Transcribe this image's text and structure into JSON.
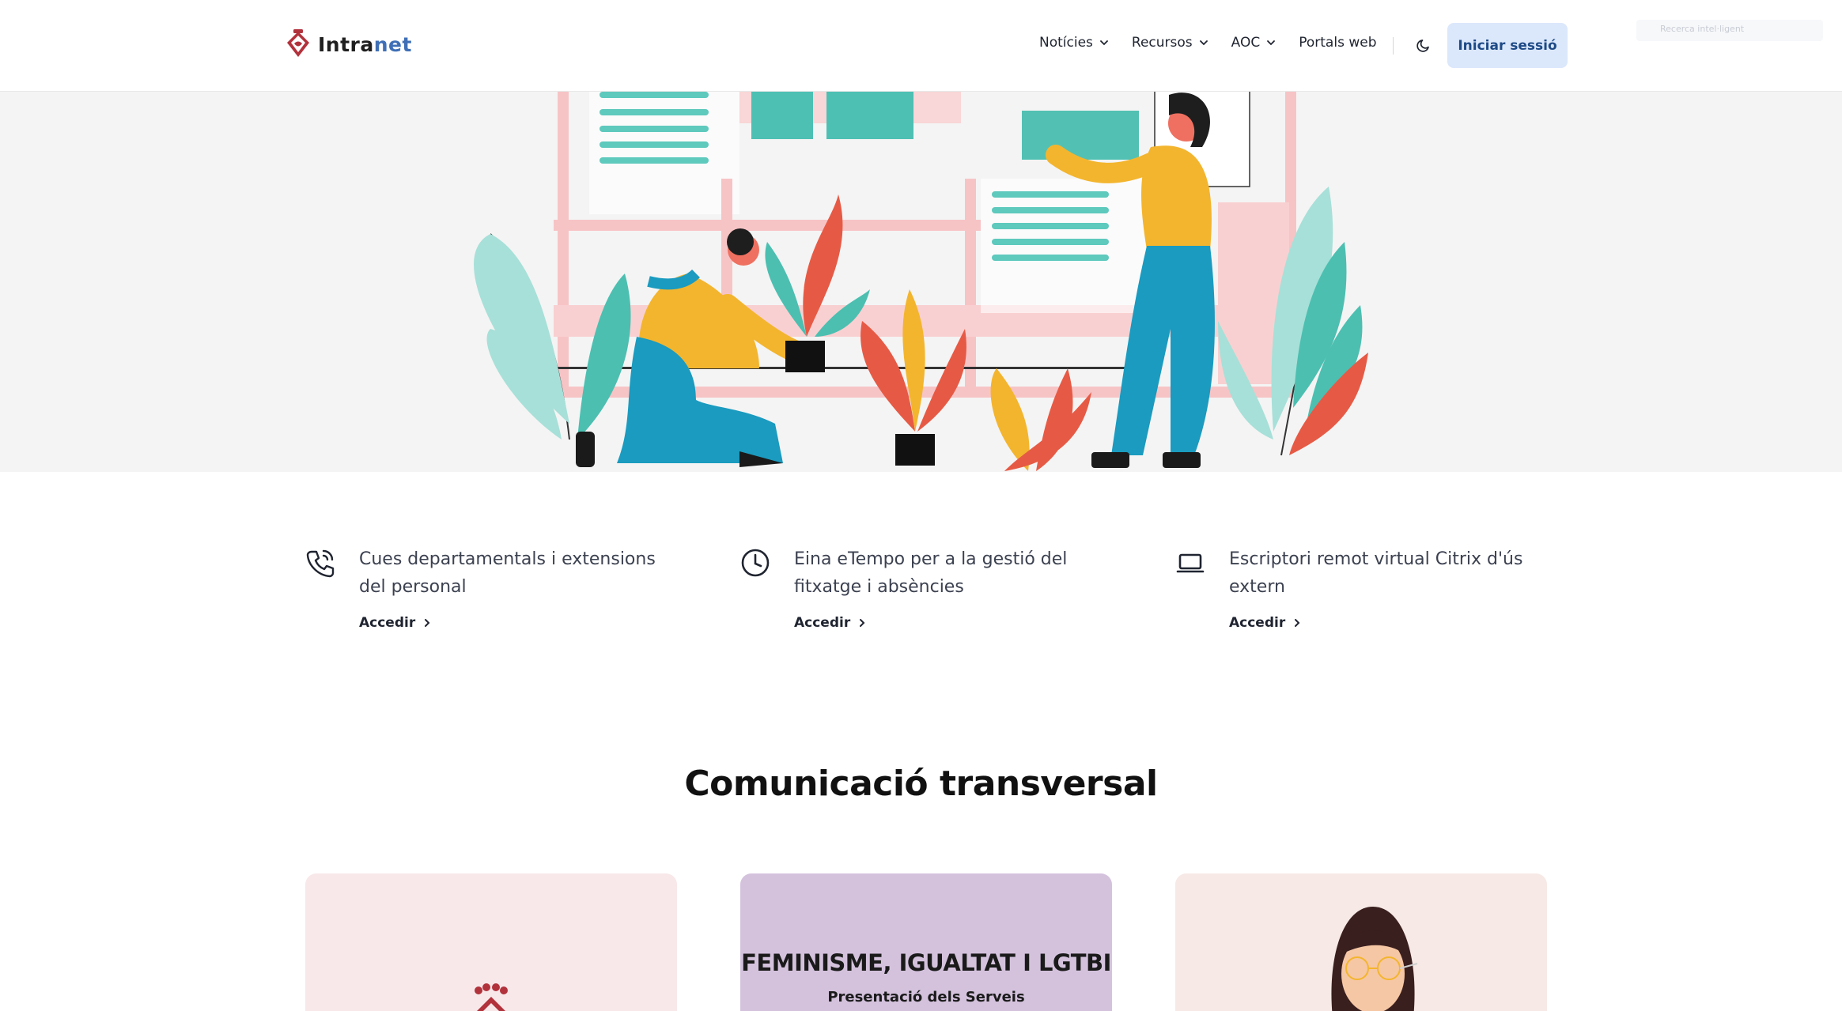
{
  "header": {
    "logo_text_a": "Intra",
    "logo_text_b": "net",
    "nav": [
      {
        "label": "Notícies",
        "has_dropdown": true
      },
      {
        "label": "Recursos",
        "has_dropdown": true
      },
      {
        "label": "AOC",
        "has_dropdown": true
      },
      {
        "label": "Portals web",
        "has_dropdown": false
      }
    ],
    "theme_toggle_icon": "moon-icon",
    "login_label": "Iniciar sessió",
    "mini_search_placeholder": "Recerca intel·ligent"
  },
  "quick_links": [
    {
      "icon": "phone-call-icon",
      "title": "Cues departamentals i extensions del personal",
      "link": "Accedir"
    },
    {
      "icon": "clock-icon",
      "title": "Eina eTempo per a la gestió del fitxatge i absències",
      "link": "Accedir"
    },
    {
      "icon": "laptop-icon",
      "title": "Escriptori remot virtual Citrix d'ús extern",
      "link": "Accedir"
    }
  ],
  "section": {
    "title": "Comunicació transversal"
  },
  "cards": [
    {
      "background": "#f8e8e9"
    },
    {
      "background": "#d4c2dd",
      "title": "FEMINISME, IGUALTAT I LGTBI",
      "subtitle": "Presentació dels Serveis"
    },
    {
      "background": "#f6e9e6"
    }
  ],
  "colors": {
    "accent": "#dbe7fb",
    "accent_text": "#1e4a86",
    "brand_red": "#b2323c"
  }
}
